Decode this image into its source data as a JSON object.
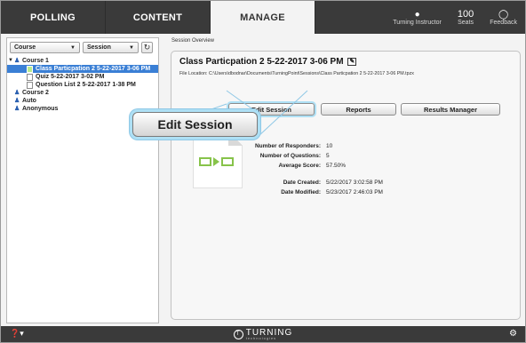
{
  "nav": {
    "tabs": [
      {
        "label": "POLLING"
      },
      {
        "label": "CONTENT"
      },
      {
        "label": "MANAGE"
      }
    ],
    "account": {
      "label": "Turning Instructor",
      "icon": "account-icon"
    },
    "seats": {
      "count": "100",
      "label": "Seats"
    },
    "feedback": {
      "label": "Feedback",
      "icon": "feedback-icon"
    }
  },
  "sidebar": {
    "course_filter": "Course",
    "session_filter": "Session",
    "tree": [
      {
        "label": "Course 1",
        "type": "group",
        "expanded": true
      },
      {
        "label": "Class Particpation 2 5-22-2017 3-06 PM",
        "type": "session",
        "selected": true
      },
      {
        "label": "Quiz 5-22-2017 3-02 PM",
        "type": "session"
      },
      {
        "label": "Question List 2 5-22-2017 1-38 PM",
        "type": "session"
      },
      {
        "label": "Course 2",
        "type": "group"
      },
      {
        "label": "Auto",
        "type": "group"
      },
      {
        "label": "Anonymous",
        "type": "group"
      }
    ]
  },
  "overview": {
    "section_title": "Session Overview",
    "session_name": "Class Particpation 2 5-22-2017 3-06 PM",
    "file_location": "File Location: C:\\Users\\dbodnar\\Documents\\TurningPoint\\Sessions\\Class Particpation 2 5-22-2017 3-06 PM.tpzx",
    "buttons": {
      "edit_session": "Edit Session",
      "reports": "Reports",
      "results_manager": "Results Manager"
    },
    "stats": [
      {
        "label": "Number of Responders:",
        "value": "10"
      },
      {
        "label": "Number of Questions:",
        "value": "5"
      },
      {
        "label": "Average Score:",
        "value": "57.50%"
      },
      {
        "label": "Date Created:",
        "value": "5/22/2017 3:02:58 PM"
      },
      {
        "label": "Date Modified:",
        "value": "5/23/2017 2:46:03 PM"
      }
    ]
  },
  "callout": {
    "label": "Edit Session"
  },
  "footer": {
    "logo_text": "TURNING",
    "logo_sub": "technologies"
  },
  "colors": {
    "nav_bg": "#3a3a3a",
    "selection": "#3a7fd5",
    "highlight": "#aee0f5",
    "file_icon": "#87c34a"
  }
}
